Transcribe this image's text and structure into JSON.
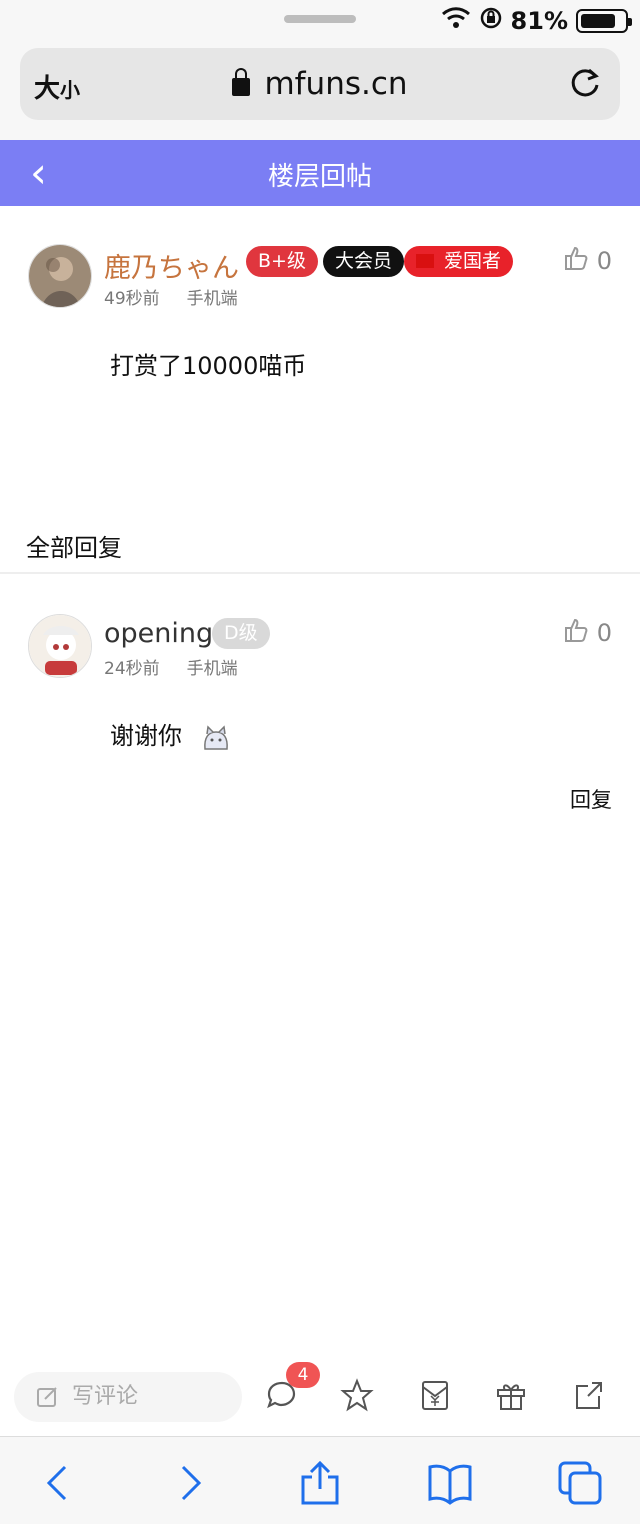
{
  "status": {
    "battery": "81%",
    "battery_level": 0.81
  },
  "browser": {
    "text_size": "大",
    "text_size_small": "小",
    "url": "mfuns.cn"
  },
  "header": {
    "back_glyph": "‹",
    "title": "楼层回帖"
  },
  "main_post": {
    "author": "鹿乃ちゃん",
    "badges": [
      "B+级",
      "大会员",
      "爱国者"
    ],
    "time": "49秒前",
    "device": "手机端",
    "like_count": "0",
    "content": "打赏了10000喵币"
  },
  "replies_section": {
    "title": "全部回复"
  },
  "reply": {
    "author": "opening",
    "level": "D级",
    "time": "24秒前",
    "device": "手机端",
    "like_count": "0",
    "content": "谢谢你",
    "reply_label": "回复"
  },
  "toolbar": {
    "comment_placeholder": "写评论",
    "comment_count": "4",
    "icons": [
      "comment-icon",
      "star-icon",
      "red-packet-icon",
      "gift-icon",
      "share-icon"
    ]
  },
  "safari": {
    "icons": [
      "back-icon",
      "forward-icon",
      "share-icon",
      "bookmarks-icon",
      "tabs-icon"
    ]
  }
}
